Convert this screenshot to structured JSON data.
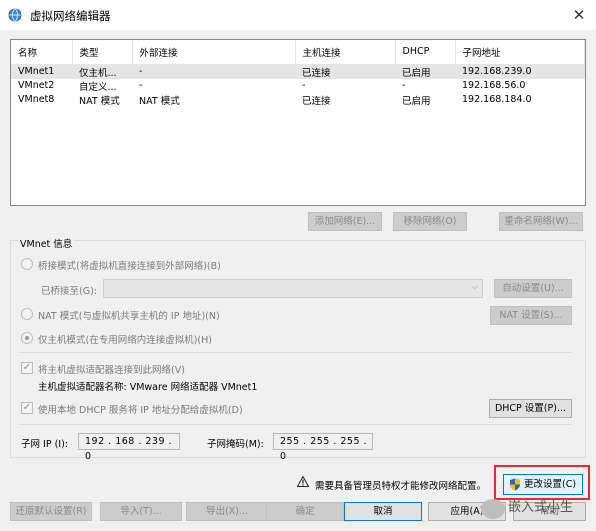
{
  "window": {
    "title": "虚拟网络编辑器",
    "close_label": "✕"
  },
  "table": {
    "headers": [
      "名称",
      "类型",
      "外部连接",
      "主机连接",
      "DHCP",
      "子网地址"
    ],
    "rows": [
      [
        "VMnet1",
        "仅主机...",
        "-",
        "已连接",
        "已启用",
        "192.168.239.0"
      ],
      [
        "VMnet2",
        "自定义...",
        "-",
        "-",
        "-",
        "192.168.56.0"
      ],
      [
        "VMnet8",
        "NAT 模式",
        "NAT 模式",
        "已连接",
        "已启用",
        "192.168.184.0"
      ]
    ],
    "selected_row": 0
  },
  "table_buttons": {
    "add": "添加网络(E)...",
    "remove": "移除网络(O)",
    "rename": "重命名网络(W)..."
  },
  "vmnet_info": {
    "legend": "VMnet 信息",
    "bridged_label": "桥接模式(将虚拟机直接连接到外部网络)(B)",
    "bridged_to_label": "已桥接至(G):",
    "bridged_to_value": "",
    "auto_settings": "自动设置(U)...",
    "nat_label": "NAT 模式(与虚拟机共享主机的 IP 地址)(N)",
    "nat_settings": "NAT 设置(S)...",
    "host_only_label": "仅主机模式(在专用网络内连接虚拟机)(H)",
    "connect_host_adapter_label": "将主机虚拟适配器连接到此网络(V)",
    "host_adapter_name_label": "主机虚拟适配器名称: VMware 网络适配器 VMnet1",
    "use_dhcp_label": "使用本地 DHCP 服务将 IP 地址分配给虚拟机(D)",
    "dhcp_settings": "DHCP 设置(P)...",
    "subnet_ip_label": "子网 IP (I):",
    "subnet_ip_value": "192 . 168 . 239 .  0",
    "subnet_mask_label": "子网掩码(M):",
    "subnet_mask_value": "255 . 255 . 255 .  0"
  },
  "admin_notice": "需要具备管理员特权才能修改网络配置。",
  "change_settings": "更改设置(C)",
  "bottom_buttons": {
    "restore": "还原默认设置(R)",
    "import": "导入(T)...",
    "export": "导出(X)...",
    "ok": "确定",
    "cancel": "取消",
    "apply": "应用(A)",
    "help": "帮助"
  },
  "watermark": "嵌入式小生"
}
